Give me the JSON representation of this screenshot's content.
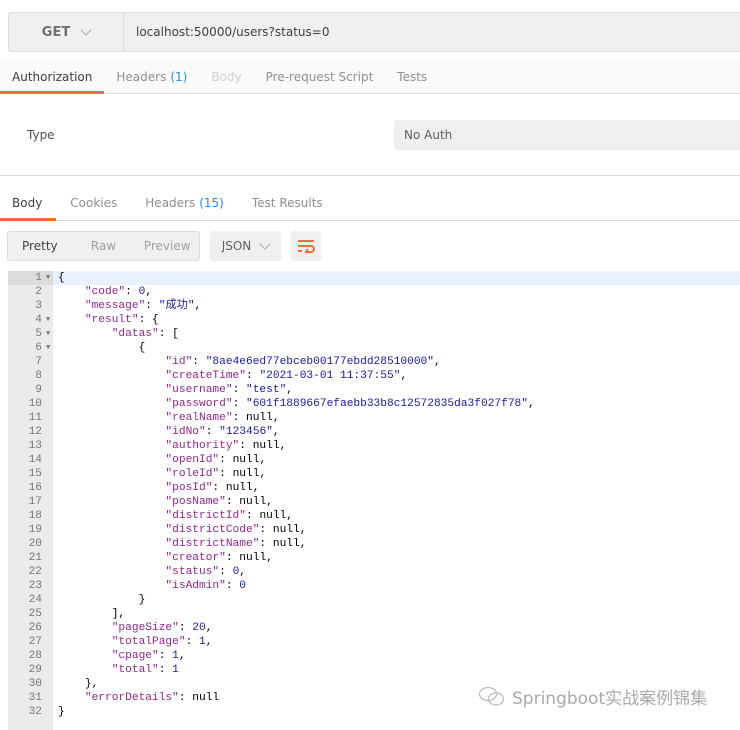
{
  "request": {
    "method": "GET",
    "url": "localhost:50000/users?status=0"
  },
  "request_tabs": [
    {
      "label": "Authorization",
      "state": "active"
    },
    {
      "label": "Headers",
      "count": "(1)"
    },
    {
      "label": "Body",
      "state": "disabled"
    },
    {
      "label": "Pre-request Script"
    },
    {
      "label": "Tests"
    }
  ],
  "auth": {
    "type_label": "Type",
    "value": "No Auth"
  },
  "response_tabs": [
    {
      "label": "Body",
      "state": "active"
    },
    {
      "label": "Cookies"
    },
    {
      "label": "Headers",
      "count": "(15)"
    },
    {
      "label": "Test Results"
    }
  ],
  "toolbar": {
    "modes": [
      "Pretty",
      "Raw",
      "Preview"
    ],
    "format": "JSON"
  },
  "colors": {
    "accent": "#f26b3a",
    "count": "#2a8ef0",
    "key": "#92278f",
    "string": "#1a1aa6"
  },
  "lines": [
    {
      "i": 0,
      "f": 1,
      "t": [
        [
          "p",
          "{"
        ]
      ]
    },
    {
      "i": 1,
      "t": [
        [
          "k",
          "\"code\""
        ],
        [
          "p",
          ": "
        ],
        [
          "n",
          "0"
        ],
        [
          "p",
          ","
        ]
      ]
    },
    {
      "i": 1,
      "t": [
        [
          "k",
          "\"message\""
        ],
        [
          "p",
          ": "
        ],
        [
          "s",
          "\"成功\""
        ],
        [
          "p",
          ","
        ]
      ]
    },
    {
      "i": 1,
      "f": 1,
      "t": [
        [
          "k",
          "\"result\""
        ],
        [
          "p",
          ": {"
        ]
      ]
    },
    {
      "i": 2,
      "f": 1,
      "t": [
        [
          "k",
          "\"datas\""
        ],
        [
          "p",
          ": ["
        ]
      ]
    },
    {
      "i": 3,
      "f": 1,
      "t": [
        [
          "p",
          "{"
        ]
      ]
    },
    {
      "i": 4,
      "t": [
        [
          "k",
          "\"id\""
        ],
        [
          "p",
          ": "
        ],
        [
          "s",
          "\"8ae4e6ed77ebceb00177ebdd28510000\""
        ],
        [
          "p",
          ","
        ]
      ]
    },
    {
      "i": 4,
      "t": [
        [
          "k",
          "\"createTime\""
        ],
        [
          "p",
          ": "
        ],
        [
          "s",
          "\"2021-03-01 11:37:55\""
        ],
        [
          "p",
          ","
        ]
      ]
    },
    {
      "i": 4,
      "t": [
        [
          "k",
          "\"username\""
        ],
        [
          "p",
          ": "
        ],
        [
          "s",
          "\"test\""
        ],
        [
          "p",
          ","
        ]
      ]
    },
    {
      "i": 4,
      "t": [
        [
          "k",
          "\"password\""
        ],
        [
          "p",
          ": "
        ],
        [
          "s",
          "\"601f1889667efaebb33b8c12572835da3f027f78\""
        ],
        [
          "p",
          ","
        ]
      ]
    },
    {
      "i": 4,
      "t": [
        [
          "k",
          "\"realName\""
        ],
        [
          "p",
          ": "
        ],
        [
          "l",
          "null"
        ],
        [
          "p",
          ","
        ]
      ]
    },
    {
      "i": 4,
      "t": [
        [
          "k",
          "\"idNo\""
        ],
        [
          "p",
          ": "
        ],
        [
          "s",
          "\"123456\""
        ],
        [
          "p",
          ","
        ]
      ]
    },
    {
      "i": 4,
      "t": [
        [
          "k",
          "\"authority\""
        ],
        [
          "p",
          ": "
        ],
        [
          "l",
          "null"
        ],
        [
          "p",
          ","
        ]
      ]
    },
    {
      "i": 4,
      "t": [
        [
          "k",
          "\"openId\""
        ],
        [
          "p",
          ": "
        ],
        [
          "l",
          "null"
        ],
        [
          "p",
          ","
        ]
      ]
    },
    {
      "i": 4,
      "t": [
        [
          "k",
          "\"roleId\""
        ],
        [
          "p",
          ": "
        ],
        [
          "l",
          "null"
        ],
        [
          "p",
          ","
        ]
      ]
    },
    {
      "i": 4,
      "t": [
        [
          "k",
          "\"posId\""
        ],
        [
          "p",
          ": "
        ],
        [
          "l",
          "null"
        ],
        [
          "p",
          ","
        ]
      ]
    },
    {
      "i": 4,
      "t": [
        [
          "k",
          "\"posName\""
        ],
        [
          "p",
          ": "
        ],
        [
          "l",
          "null"
        ],
        [
          "p",
          ","
        ]
      ]
    },
    {
      "i": 4,
      "t": [
        [
          "k",
          "\"districtId\""
        ],
        [
          "p",
          ": "
        ],
        [
          "l",
          "null"
        ],
        [
          "p",
          ","
        ]
      ]
    },
    {
      "i": 4,
      "t": [
        [
          "k",
          "\"districtCode\""
        ],
        [
          "p",
          ": "
        ],
        [
          "l",
          "null"
        ],
        [
          "p",
          ","
        ]
      ]
    },
    {
      "i": 4,
      "t": [
        [
          "k",
          "\"districtName\""
        ],
        [
          "p",
          ": "
        ],
        [
          "l",
          "null"
        ],
        [
          "p",
          ","
        ]
      ]
    },
    {
      "i": 4,
      "t": [
        [
          "k",
          "\"creator\""
        ],
        [
          "p",
          ": "
        ],
        [
          "l",
          "null"
        ],
        [
          "p",
          ","
        ]
      ]
    },
    {
      "i": 4,
      "t": [
        [
          "k",
          "\"status\""
        ],
        [
          "p",
          ": "
        ],
        [
          "n",
          "0"
        ],
        [
          "p",
          ","
        ]
      ]
    },
    {
      "i": 4,
      "t": [
        [
          "k",
          "\"isAdmin\""
        ],
        [
          "p",
          ": "
        ],
        [
          "n",
          "0"
        ]
      ]
    },
    {
      "i": 3,
      "t": [
        [
          "p",
          "}"
        ]
      ]
    },
    {
      "i": 2,
      "t": [
        [
          "p",
          "],"
        ]
      ]
    },
    {
      "i": 2,
      "t": [
        [
          "k",
          "\"pageSize\""
        ],
        [
          "p",
          ": "
        ],
        [
          "n",
          "20"
        ],
        [
          "p",
          ","
        ]
      ]
    },
    {
      "i": 2,
      "t": [
        [
          "k",
          "\"totalPage\""
        ],
        [
          "p",
          ": "
        ],
        [
          "n",
          "1"
        ],
        [
          "p",
          ","
        ]
      ]
    },
    {
      "i": 2,
      "t": [
        [
          "k",
          "\"cpage\""
        ],
        [
          "p",
          ": "
        ],
        [
          "n",
          "1"
        ],
        [
          "p",
          ","
        ]
      ]
    },
    {
      "i": 2,
      "t": [
        [
          "k",
          "\"total\""
        ],
        [
          "p",
          ": "
        ],
        [
          "n",
          "1"
        ]
      ]
    },
    {
      "i": 1,
      "t": [
        [
          "p",
          "},"
        ]
      ]
    },
    {
      "i": 1,
      "t": [
        [
          "k",
          "\"errorDetails\""
        ],
        [
          "p",
          ": "
        ],
        [
          "l",
          "null"
        ]
      ]
    },
    {
      "i": 0,
      "t": [
        [
          "p",
          "}"
        ]
      ]
    }
  ],
  "watermark": "Springboot实战案例锦集"
}
